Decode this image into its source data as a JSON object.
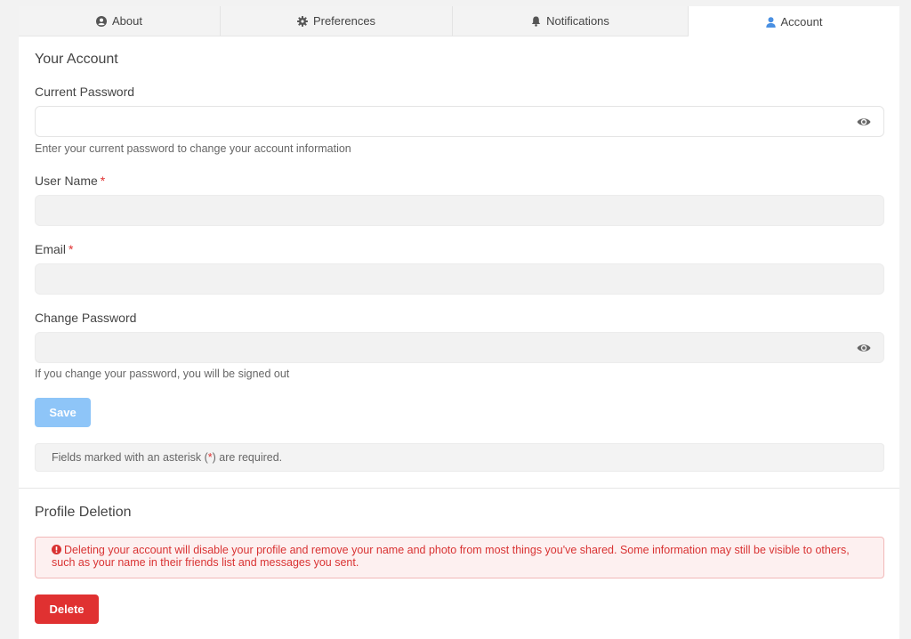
{
  "tabs": [
    {
      "label": "About",
      "icon": "user-circle-icon"
    },
    {
      "label": "Preferences",
      "icon": "gear-icon"
    },
    {
      "label": "Notifications",
      "icon": "bell-icon"
    },
    {
      "label": "Account",
      "icon": "user-icon",
      "active": true
    }
  ],
  "account": {
    "title": "Your Account",
    "current_password": {
      "label": "Current Password",
      "value": "",
      "help": "Enter your current password to change your account information"
    },
    "username": {
      "label": "User Name",
      "required_mark": "*",
      "value": ""
    },
    "email": {
      "label": "Email",
      "required_mark": "*",
      "value": ""
    },
    "change_password": {
      "label": "Change Password",
      "value": "",
      "help": "If you change your password, you will be signed out"
    },
    "save_label": "Save",
    "note_prefix": "Fields marked with an asterisk (",
    "note_mark": "*",
    "note_suffix": ") are required."
  },
  "deletion": {
    "title": "Profile Deletion",
    "warning": "Deleting your account will disable your profile and remove your name and photo from most things you've shared. Some information may still be visible to others, such as your name in their friends list and messages you sent.",
    "delete_label": "Delete"
  },
  "colors": {
    "accent": "#4a90e2",
    "save_button": "#8ec5f8",
    "danger": "#e03131",
    "alert_bg": "#fdf0f0"
  }
}
